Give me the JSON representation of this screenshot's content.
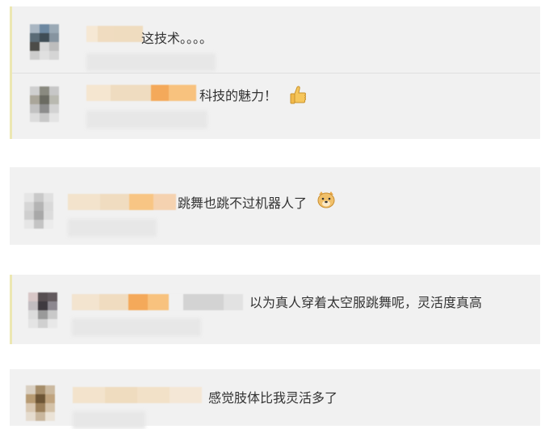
{
  "comments": [
    {
      "text": "这技术。。。。",
      "emoji": ""
    },
    {
      "text": "科技的魅力！",
      "emoji": "thumbs-up-icon"
    },
    {
      "text": "跳舞也跳不过机器人了",
      "emoji": "doge-icon"
    },
    {
      "text": "以为真人穿着太空服跳舞呢，灵活度真高",
      "emoji": ""
    },
    {
      "text": "感觉肢体比我灵活多了",
      "emoji": ""
    }
  ],
  "colors": {
    "card_bg": "#f1f1f1",
    "accent_bar": "#ece7b2",
    "nick_blur": "#f0d9b5",
    "nick_highlight": "#f7b96b"
  }
}
